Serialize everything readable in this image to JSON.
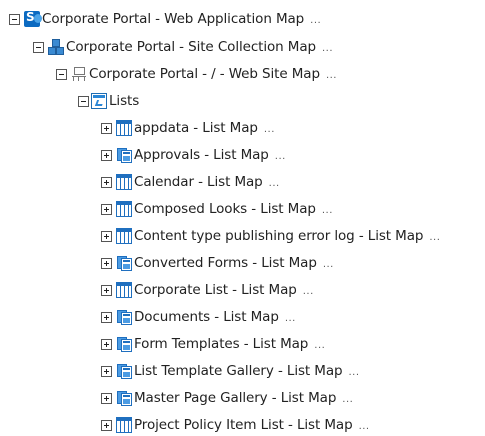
{
  "tree": {
    "web_application": {
      "label": "Corporate Portal - Web Application Map",
      "more": "..."
    },
    "site_collection": {
      "label": "Corporate Portal - Site Collection Map",
      "more": "..."
    },
    "web_site": {
      "label": "Corporate Portal - / - Web Site Map",
      "more": "..."
    },
    "lists_folder": {
      "label": "Lists"
    },
    "lists": [
      {
        "label": "appdata - List Map",
        "more": "...",
        "icon": "list-table-icon"
      },
      {
        "label": "Approvals - List Map",
        "more": "...",
        "icon": "document-library-icon"
      },
      {
        "label": "Calendar - List Map",
        "more": "...",
        "icon": "list-table-icon"
      },
      {
        "label": "Composed Looks - List Map",
        "more": "...",
        "icon": "list-table-icon"
      },
      {
        "label": "Content type publishing error log - List Map",
        "more": "...",
        "icon": "list-table-icon"
      },
      {
        "label": "Converted Forms - List Map",
        "more": "...",
        "icon": "document-library-icon"
      },
      {
        "label": "Corporate List - List Map",
        "more": "...",
        "icon": "list-table-icon"
      },
      {
        "label": "Documents - List Map",
        "more": "...",
        "icon": "document-library-icon"
      },
      {
        "label": "Form Templates - List Map",
        "more": "...",
        "icon": "document-library-icon"
      },
      {
        "label": "List Template Gallery - List Map",
        "more": "...",
        "icon": "document-library-icon"
      },
      {
        "label": "Master Page Gallery - List Map",
        "more": "...",
        "icon": "document-library-icon"
      },
      {
        "label": "Project Policy Item List - List Map",
        "more": "...",
        "icon": "list-table-icon"
      }
    ]
  },
  "colors": {
    "icon_blue": "#1f6fbf",
    "background": "#ffffff"
  }
}
